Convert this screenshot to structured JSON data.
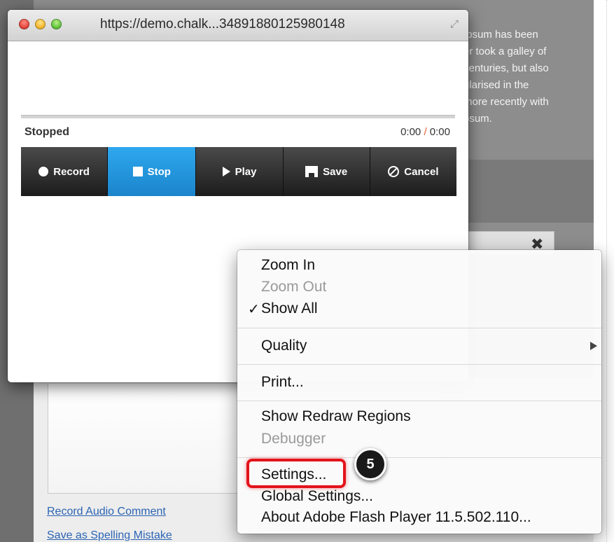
{
  "background": {
    "lorem_lines": [
      "Ipsum has been",
      "er took a galley of",
      "centuries, but also",
      "ularised in the",
      "more recently with",
      "psum."
    ],
    "links": [
      "Record Audio Comment",
      "Save as Spelling Mistake"
    ]
  },
  "popup": {
    "title": "https://demo.chalk...34891880125980148",
    "status": "Stopped",
    "time_elapsed": "0:00",
    "time_separator": "/",
    "time_total": "0:00",
    "buttons": [
      {
        "label": "Record",
        "icon": "record-icon"
      },
      {
        "label": "Stop",
        "icon": "stop-icon",
        "active": true
      },
      {
        "label": "Play",
        "icon": "play-icon"
      },
      {
        "label": "Save",
        "icon": "save-icon"
      },
      {
        "label": "Cancel",
        "icon": "cancel-icon"
      }
    ]
  },
  "context_menu": {
    "zoom_in": "Zoom In",
    "zoom_out": "Zoom Out",
    "show_all": "Show All",
    "show_all_check": "✓",
    "quality": "Quality",
    "print": "Print...",
    "show_redraw": "Show Redraw Regions",
    "debugger": "Debugger",
    "settings": "Settings...",
    "global_settings": "Global Settings...",
    "about": "About Adobe Flash Player 11.5.502.110..."
  },
  "callout": {
    "step_number": "5",
    "highlight_color": "#e3131b"
  },
  "colors": {
    "active_button": "#1b84cb",
    "timer_separator": "#e0612a",
    "link": "#2b64b3"
  }
}
